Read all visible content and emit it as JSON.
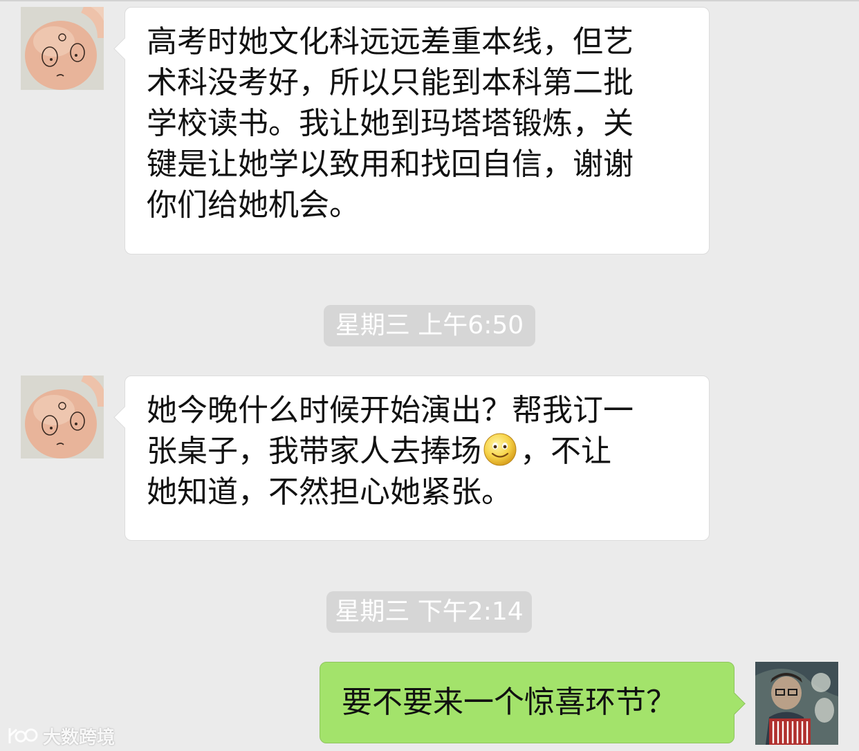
{
  "messages": [
    {
      "sender": "contact",
      "lines": [
        "高考时她文化科远远差重本线，但艺",
        "术科没考好，所以只能到本科第二批",
        "学校读书。我让她到玛塔塔锻炼，关",
        "键是让她学以致用和找回自信，谢谢",
        "你们给她机会。"
      ]
    },
    {
      "timestamp": "星期三 上午6:50"
    },
    {
      "sender": "contact",
      "lines": [
        "她今晚什么时候开始演出？帮我订一",
        "张桌子，我带家人去捧场",
        "，不让",
        "她知道，不然担心她紧张。"
      ],
      "emoji": "smiley-face-icon"
    },
    {
      "timestamp": "星期三 下午2:14"
    },
    {
      "sender": "self",
      "lines": [
        "要不要来一个惊喜环节？"
      ]
    }
  ],
  "watermark": {
    "text": "大数跨境"
  },
  "colors": {
    "background": "#ebebeb",
    "incoming_bubble": "#ffffff",
    "outgoing_bubble": "#a3e36b",
    "timestamp_pill": "#d6d6d6"
  }
}
